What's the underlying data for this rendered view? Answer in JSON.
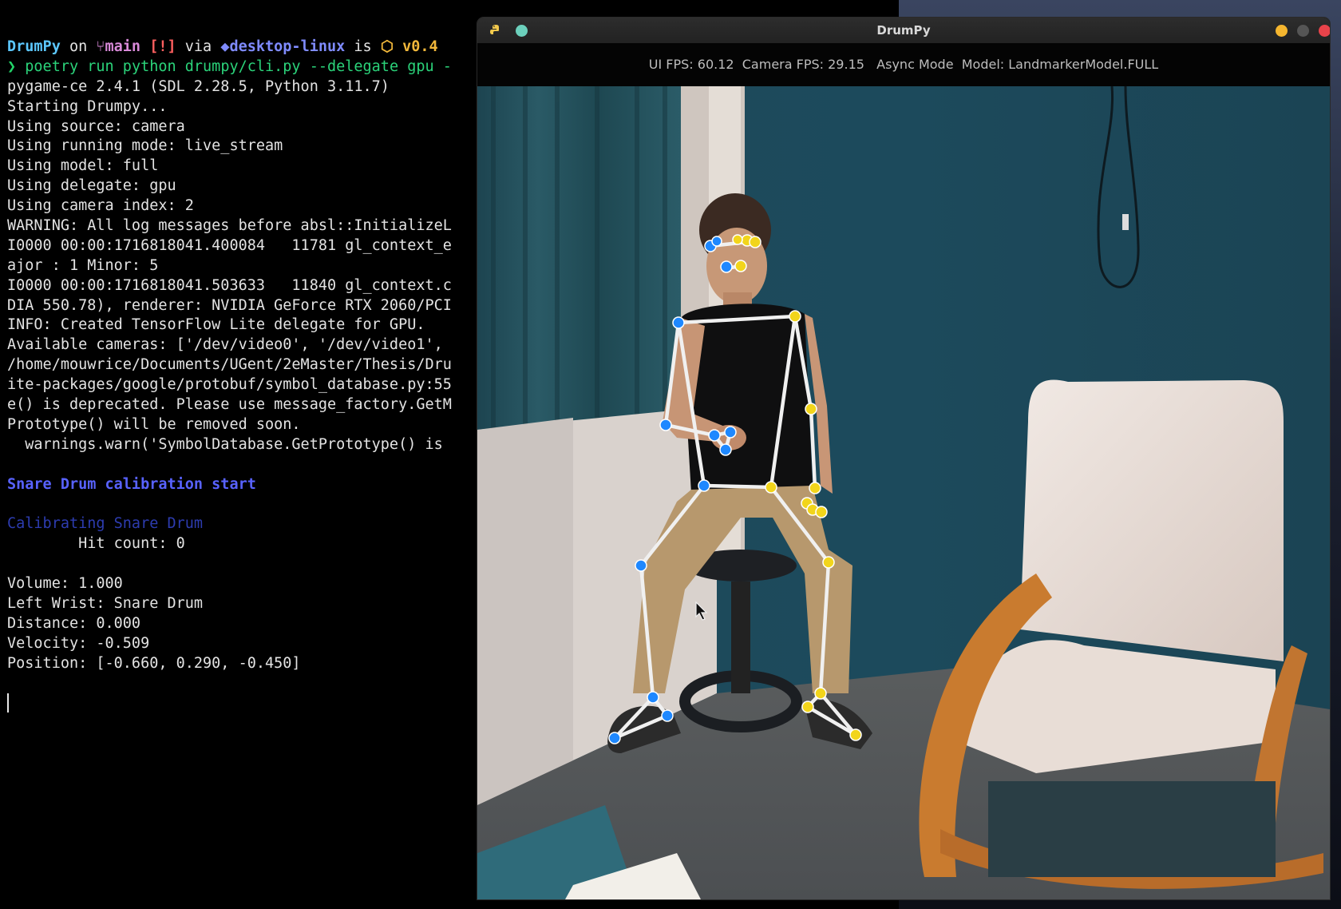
{
  "terminal": {
    "prompt": {
      "dir": "DrumPy",
      "on": " on ",
      "branch_icon": "git-branch-icon",
      "branch": "main",
      "status": "[!]",
      "via": " via ",
      "docker_icon": "docker-icon",
      "context": "desktop-linux",
      "is": " is ",
      "package_icon": "package-icon",
      "version": "v0.4",
      "arrow": "❯",
      "cmd_poetry": "poetry",
      "cmd_run": "run python drumpy/cli.py --delegate gpu -"
    },
    "lines": [
      "pygame-ce 2.4.1 (SDL 2.28.5, Python 3.11.7)",
      "Starting Drumpy...",
      "Using source: camera",
      "Using running mode: live_stream",
      "Using model: full",
      "Using delegate: gpu",
      "Using camera index: 2",
      "WARNING: All log messages before absl::InitializeL",
      "I0000 00:00:1716818041.400084   11781 gl_context_e",
      "ajor : 1 Minor: 5",
      "I0000 00:00:1716818041.503633   11840 gl_context.c",
      "DIA 550.78), renderer: NVIDIA GeForce RTX 2060/PCI",
      "INFO: Created TensorFlow Lite delegate for GPU.",
      "Available cameras: ['/dev/video0', '/dev/video1', ",
      "/home/mouwrice/Documents/UGent/2eMaster/Thesis/Dru",
      "ite-packages/google/protobuf/symbol_database.py:55",
      "e() is deprecated. Please use message_factory.GetM",
      "Prototype() will be removed soon.",
      "  warnings.warn('SymbolDatabase.GetPrototype() is "
    ],
    "calibration_start": "Snare Drum calibration start",
    "calibrating": "Calibrating Snare Drum",
    "hit_count": "        Hit count: 0",
    "stats": [
      "Volume: 1.000",
      "Left Wrist: Snare Drum",
      "Distance: 0.000",
      "Velocity: -0.509",
      "Position: [-0.660, 0.290, -0.450]"
    ]
  },
  "window": {
    "title": "DrumPy",
    "app_icon": "python-snake-icon",
    "pin_icon": "pin-circle-icon",
    "minimize_icon": "minimize-icon",
    "maximize_icon": "maximize-icon",
    "close_icon": "close-icon",
    "colors": {
      "minimize": "#f5b62f",
      "maximize": "#555555",
      "close": "#e8434a"
    }
  },
  "status_bar": {
    "text": "UI FPS: 60.12  Camera FPS: 29.15   Async Mode  Model: LandmarkerModel.FULL"
  },
  "pose_overlay": {
    "left_color": "#1e88ff",
    "right_color": "#f2d51b",
    "bone_color": "#f0f0f0"
  }
}
